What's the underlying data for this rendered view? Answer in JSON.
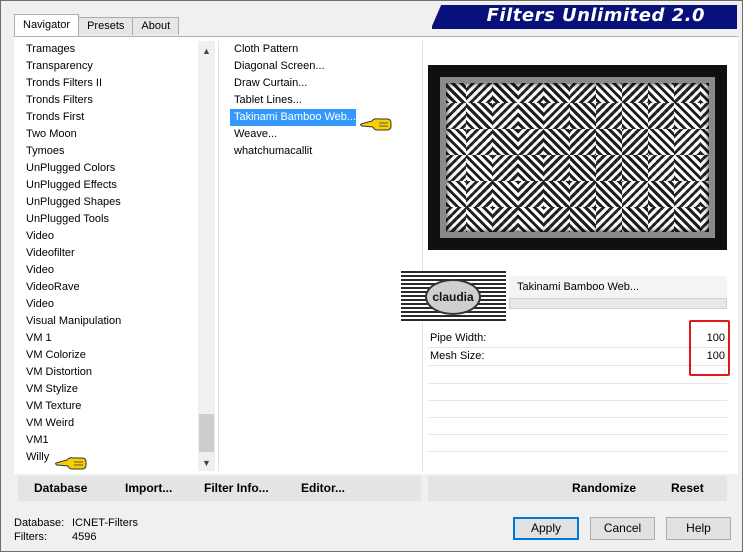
{
  "title": "Filters Unlimited 2.0",
  "tabs": [
    "Navigator",
    "Presets",
    "About"
  ],
  "categories": [
    "Tramages",
    "Transparency",
    "Tronds Filters II",
    "Tronds Filters",
    "Tronds First",
    "Two Moon",
    "Tymoes",
    "UnPlugged Colors",
    "UnPlugged Effects",
    "UnPlugged Shapes",
    "UnPlugged Tools",
    "Video",
    "Videofilter",
    "Video",
    "VideoRave",
    "Video",
    "Visual Manipulation",
    "VM 1",
    "VM Colorize",
    "VM Distortion",
    "VM Stylize",
    "VM Texture",
    "VM Weird",
    "VM1",
    "Willy"
  ],
  "filters": [
    "Cloth Pattern",
    "Diagonal Screen...",
    "Draw Curtain...",
    "Tablet Lines...",
    "Takinami Bamboo Web...",
    "Weave...",
    "whatchumacallit"
  ],
  "selected_filter_index": 4,
  "filter_name": "Takinami Bamboo Web...",
  "logo_text": "claudia",
  "params": [
    {
      "label": "Pipe Width:",
      "value": "100"
    },
    {
      "label": "Mesh Size:",
      "value": "100"
    }
  ],
  "buttons": {
    "database": "Database",
    "import": "Import...",
    "filter_info": "Filter Info...",
    "editor": "Editor...",
    "randomize": "Randomize",
    "reset": "Reset",
    "apply": "Apply",
    "cancel": "Cancel",
    "help": "Help"
  },
  "status": {
    "database_label": "Database:",
    "database_value": "ICNET-Filters",
    "filters_label": "Filters:",
    "filters_value": "4596"
  },
  "colors": {
    "banner": "#08107a",
    "selection": "#3399ff",
    "highlight_box": "#e0161c",
    "hand": "#f5d000"
  }
}
